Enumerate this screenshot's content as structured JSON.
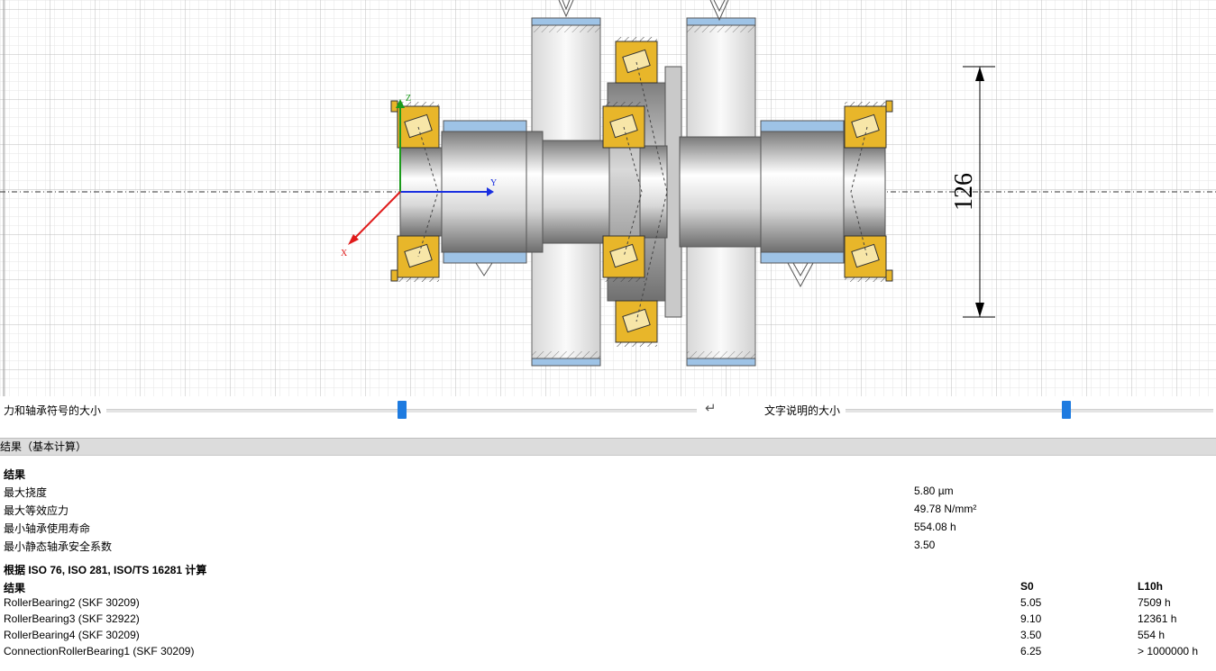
{
  "canvas": {
    "dimension_label": "126",
    "axes": {
      "x": "X",
      "y": "Y",
      "z": "Z"
    },
    "colors": {
      "grid_major": "#b9b9b9",
      "grid_minor": "#e3e3e3",
      "bearing": "#e8b62a",
      "sleeve": "#9ec3e6",
      "axis_x": "#e01b1b",
      "axis_y": "#1a2fe0",
      "axis_z": "#1b9a1b"
    }
  },
  "sliders": {
    "force_label": "力和轴承符号的大小",
    "force_value": 0.5,
    "reset_glyph": "↵",
    "text_label": "文字说明的大小",
    "text_value": 0.6
  },
  "results_panel": {
    "header": "结果（基本计算）",
    "section1_title": "结果",
    "rows": [
      {
        "label": "最大挠度",
        "value": "5.80 µm"
      },
      {
        "label": "最大等效应力",
        "value": "49.78 N/mm²"
      },
      {
        "label": "最小轴承使用寿命",
        "value": "554.08 h"
      },
      {
        "label": "最小静态轴承安全系数",
        "value": "3.50"
      }
    ],
    "section2_title": "根据 ISO 76, ISO 281, ISO/TS 16281 计算",
    "table_header": {
      "name": "结果",
      "s0": "S0",
      "l10h": "L10h"
    },
    "bearings": [
      {
        "name": "RollerBearing2 (SKF 30209)",
        "s0": "5.05",
        "l10h": "7509 h"
      },
      {
        "name": "RollerBearing3 (SKF 32922)",
        "s0": "9.10",
        "l10h": "12361 h"
      },
      {
        "name": "RollerBearing4 (SKF 30209)",
        "s0": "3.50",
        "l10h": "554 h"
      },
      {
        "name": "ConnectionRollerBearing1 (SKF 30209)",
        "s0": "6.25",
        "l10h": "> 1000000 h"
      }
    ]
  }
}
